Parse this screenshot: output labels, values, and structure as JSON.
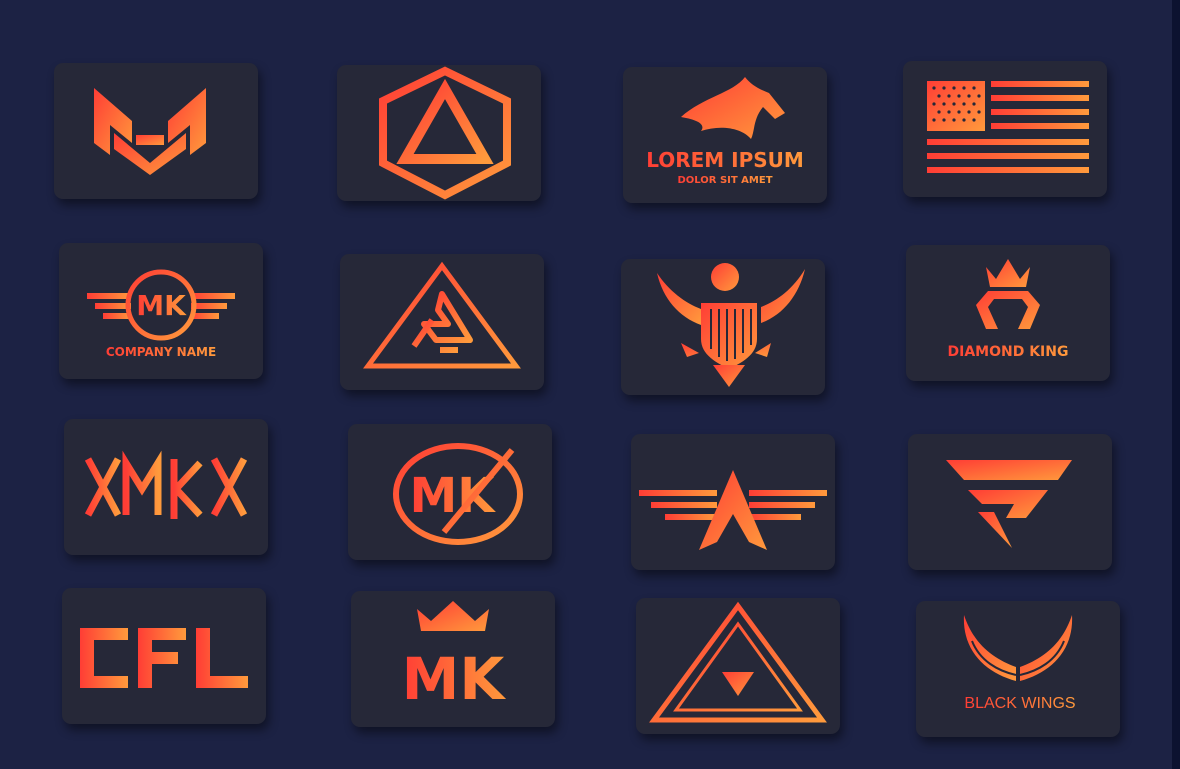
{
  "colors": {
    "background": "#1c2244",
    "card": "#262838",
    "gradient_start": "#ff3d35",
    "gradient_end": "#ff9a3c"
  },
  "logos": [
    {
      "name": "MG monogram",
      "icon": "mg-monogram-icon",
      "text": []
    },
    {
      "name": "Hexagon triangle",
      "icon": "hexagon-triangle-icon",
      "text": []
    },
    {
      "name": "Horse head",
      "icon": "horse-head-icon",
      "text": [
        "LOREM IPSUM",
        "DOLOR SIT AMET"
      ]
    },
    {
      "name": "Flag",
      "icon": "flag-icon",
      "text": []
    },
    {
      "name": "MK winged circle",
      "icon": "winged-circle-icon",
      "text": [
        "MK",
        "COMPANY NAME"
      ]
    },
    {
      "name": "Triangle knot",
      "icon": "triangle-knot-icon",
      "text": []
    },
    {
      "name": "Eagle shield",
      "icon": "eagle-shield-icon",
      "text": []
    },
    {
      "name": "Diamond king",
      "icon": "crown-diamond-icon",
      "text": [
        "DIAMOND KING"
      ]
    },
    {
      "name": "XMKX",
      "icon": "xmkx-wordmark-icon",
      "text": []
    },
    {
      "name": "MK circle",
      "icon": "mk-circle-icon",
      "text": [
        "MK"
      ]
    },
    {
      "name": "Winged A",
      "icon": "winged-a-icon",
      "text": []
    },
    {
      "name": "F mark",
      "icon": "f-mark-icon",
      "text": []
    },
    {
      "name": "CFL",
      "icon": "cfl-wordmark-icon",
      "text": []
    },
    {
      "name": "MK crown",
      "icon": "mk-crown-icon",
      "text": [
        "MK"
      ]
    },
    {
      "name": "Triangle eye",
      "icon": "triangle-eye-icon",
      "text": []
    },
    {
      "name": "Black wings",
      "icon": "wings-icon",
      "text": [
        "BLACK WINGS"
      ]
    }
  ]
}
